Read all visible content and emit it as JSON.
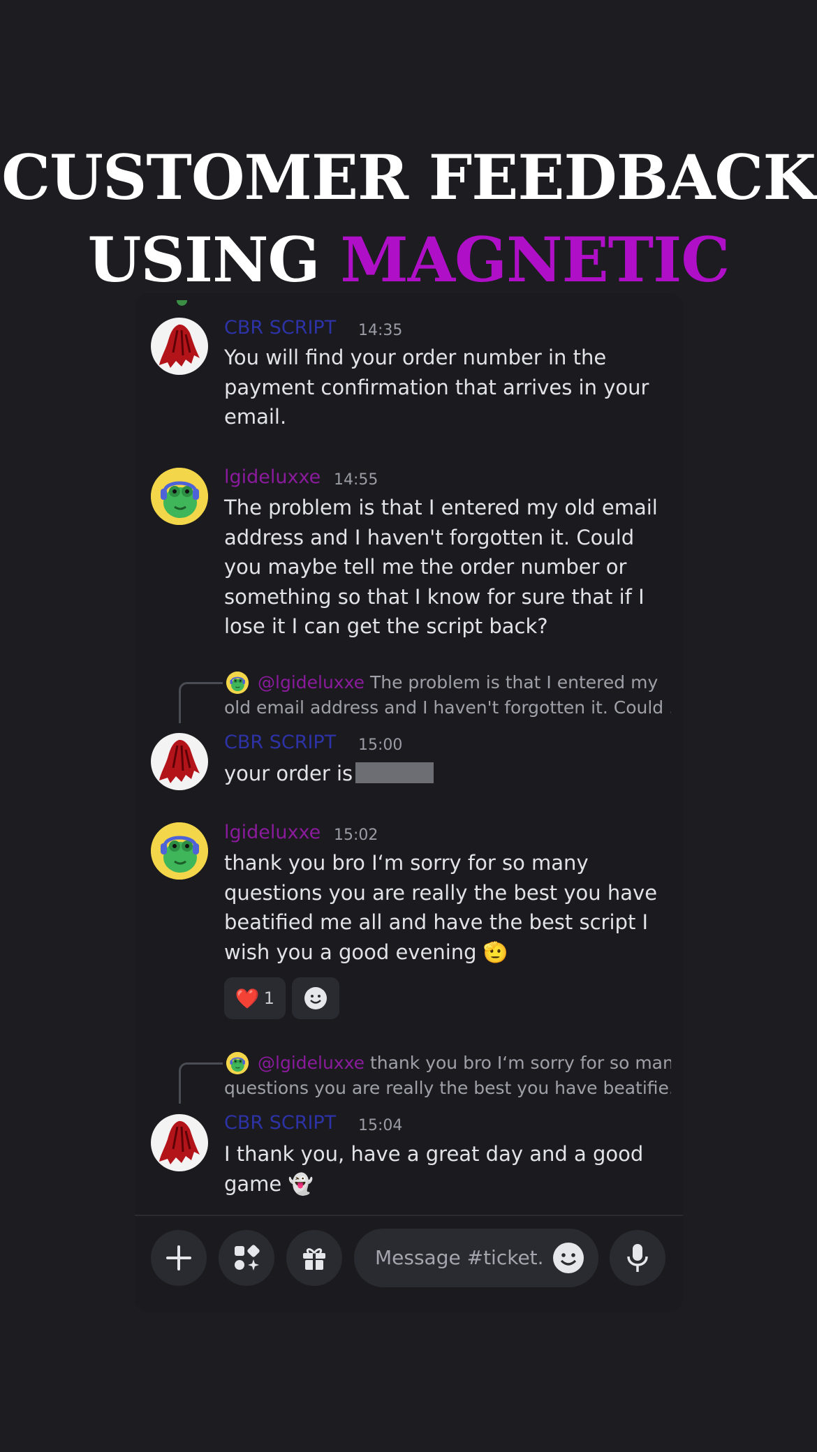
{
  "headline": {
    "line1": "CUSTOMER FEEDBACK",
    "line2_prefix": "USING ",
    "line2_accent": "MAGNETIC"
  },
  "colors": {
    "background": "#1c1c21",
    "accent": "#b00fc8",
    "cbr_name": "#2d33a6",
    "user_name": "#8a1b9c"
  },
  "messages": [
    {
      "author": "CBR SCRIPT",
      "time": "14:35",
      "text": "You will find your order number in the payment confirmation that arrives in your email."
    },
    {
      "author": "lgideluxxe",
      "time": "14:55",
      "text": "The problem is that I entered my old email address and I haven't forgotten it. Could you maybe tell me the order number or something so that I know for sure that if I lose it I can get the script back?"
    },
    {
      "reply_mention": "@lgideluxxe",
      "reply_line1": "The problem is that I entered my",
      "reply_line2": "old email address and I haven't forgotten it. Could ...",
      "author": "CBR SCRIPT",
      "time": "15:00",
      "text": "your order is"
    },
    {
      "author": "lgideluxxe",
      "time": "15:02",
      "text": "thank you bro I‘m sorry for so many questions you are really the best you have beatified me all and have the best script I wish you a good evening 🫡",
      "reactions": [
        {
          "emoji": "❤️",
          "count": "1"
        },
        {
          "emoji": "add-reaction-icon"
        }
      ]
    },
    {
      "reply_mention": "@lgideluxxe",
      "reply_line1": "thank you bro I‘m sorry for so many",
      "reply_line2": "questions you are really the best you have beatifie...",
      "author": "CBR SCRIPT",
      "time": "15:04",
      "text": "I thank you, have a great day and a good game 👻"
    }
  ],
  "composer": {
    "placeholder": "Message #ticket...",
    "buttons": [
      "plus-icon",
      "apps-icon",
      "gift-icon",
      "emoji-icon",
      "microphone-icon"
    ]
  }
}
